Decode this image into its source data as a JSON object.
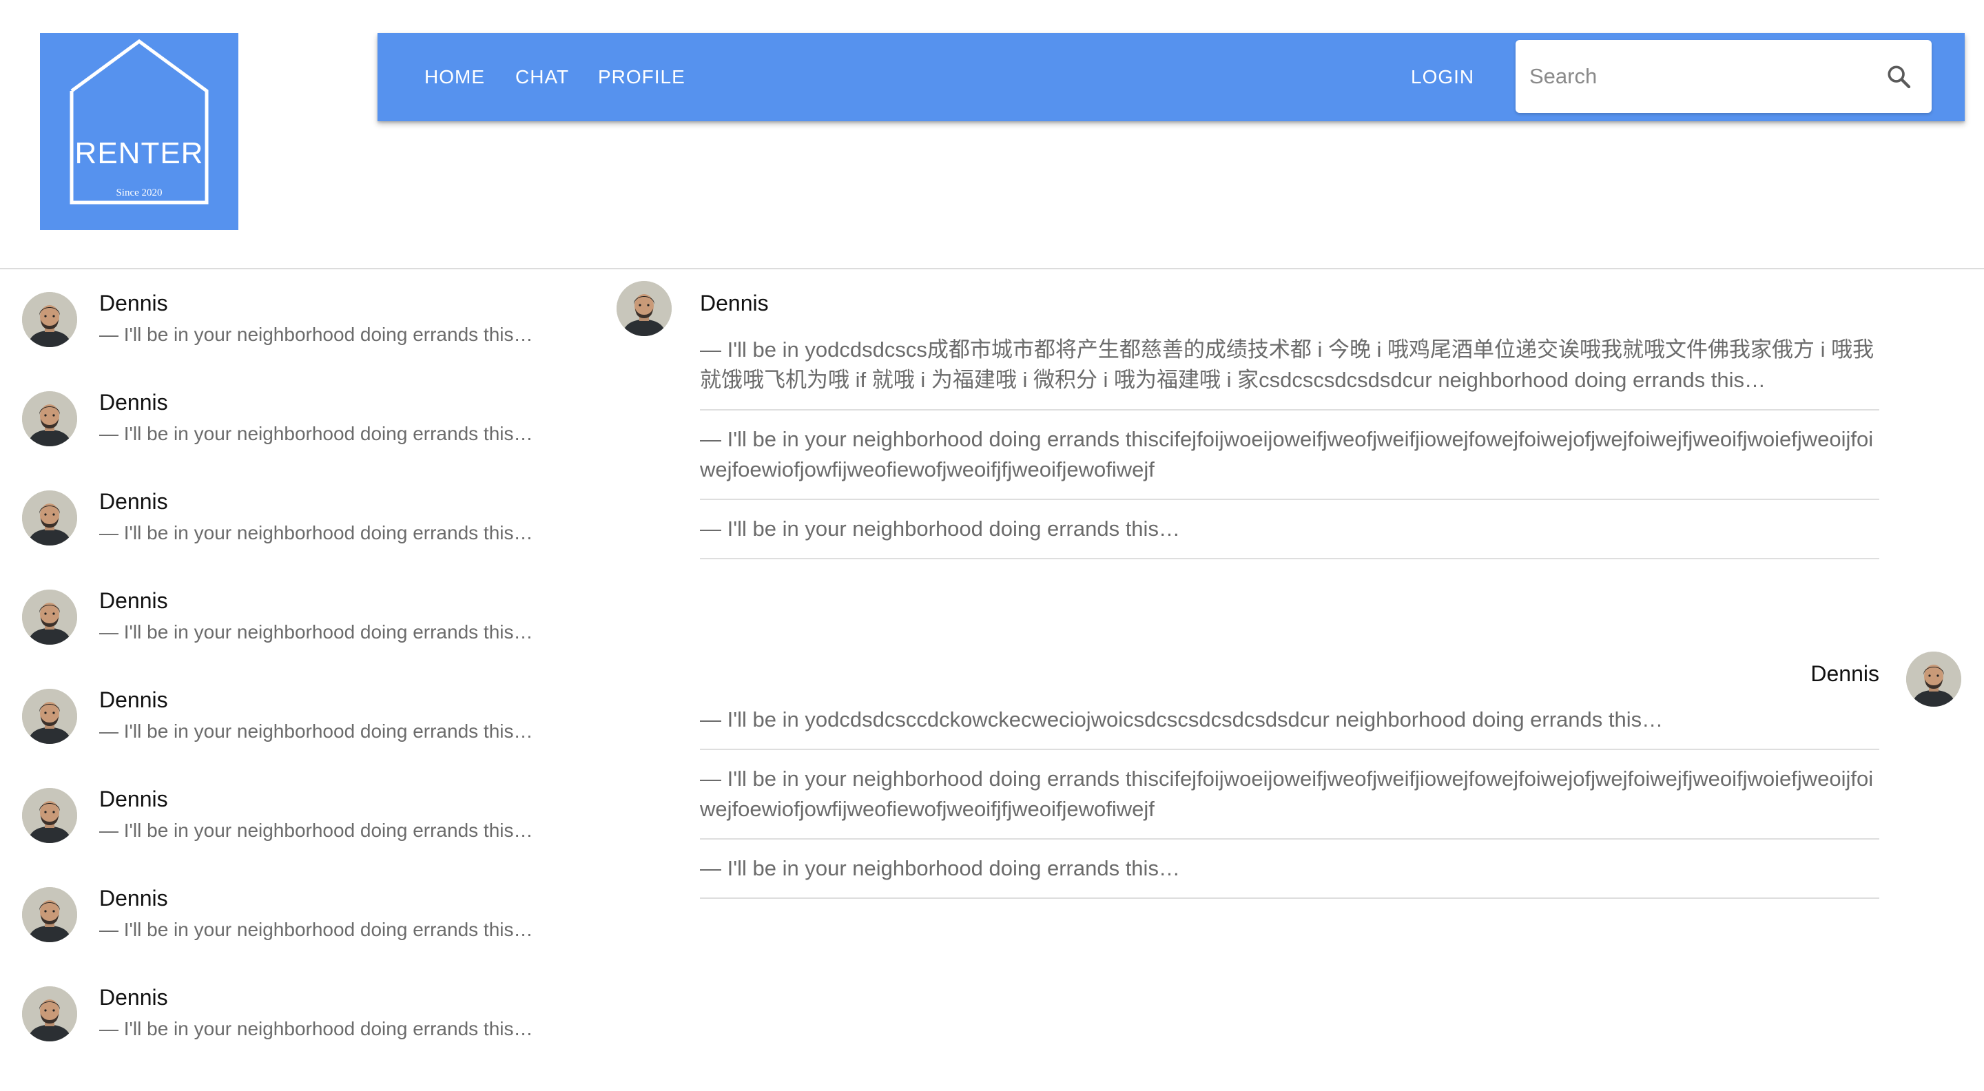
{
  "logo": {
    "name": "RENTER",
    "since": "Since 2020",
    "color": "#5692ee"
  },
  "nav": {
    "home": "HOME",
    "chat": "CHAT",
    "profile": "PROFILE",
    "login": "LOGIN"
  },
  "search": {
    "placeholder": "Search",
    "value": "",
    "icon": "search-icon"
  },
  "conversations": [
    {
      "name": "Dennis",
      "preview": "— I'll be in your neighborhood doing errands this…"
    },
    {
      "name": "Dennis",
      "preview": "— I'll be in your neighborhood doing errands this…"
    },
    {
      "name": "Dennis",
      "preview": "— I'll be in your neighborhood doing errands this…"
    },
    {
      "name": "Dennis",
      "preview": "— I'll be in your neighborhood doing errands this…"
    },
    {
      "name": "Dennis",
      "preview": "— I'll be in your neighborhood doing errands this…"
    },
    {
      "name": "Dennis",
      "preview": "— I'll be in your neighborhood doing errands this…"
    },
    {
      "name": "Dennis",
      "preview": "— I'll be in your neighborhood doing errands this…"
    },
    {
      "name": "Dennis",
      "preview": "— I'll be in your neighborhood doing errands this…"
    }
  ],
  "thread": {
    "incoming": {
      "sender": "Dennis",
      "messages": [
        "— I'll be in yodcdsdcscs成都市城市都将产生都慈善的成绩技术都 i 今晚 i 哦鸡尾酒单位递交诶哦我就哦文件佛我家俄方 i 哦我就饿哦飞机为哦 if 就哦 i 为福建哦 i 微积分 i 哦为福建哦 i 家csdcscsdcsdsdcur neighborhood doing errands this…",
        "— I'll be in your neighborhood doing errands thiscifejfoijwoeijoweifjweofjweifjiowejfowejfoiwejofjwejfoiwejfjweoifjwoiefjweoijfoiwejfoewiofjowfijweofiewofjweoifjfjweoifjewofiwejf",
        "— I'll be in your neighborhood doing errands this…"
      ]
    },
    "outgoing": {
      "sender": "Dennis",
      "messages": [
        "— I'll be in yodcdsdcsccdckowckecweciojwoicsdcscsdcsdcsdsdcur neighborhood doing errands this…",
        "— I'll be in your neighborhood doing errands thiscifejfoijwoeijoweifjweofjweifjiowejfowejfoiwejofjwejfoiwejfjweoifjwoiefjweoijfoiwejfoewiofjowfijweofiewofjweoifjfjweoifjewofiwejf",
        "— I'll be in your neighborhood doing errands this…"
      ]
    }
  }
}
